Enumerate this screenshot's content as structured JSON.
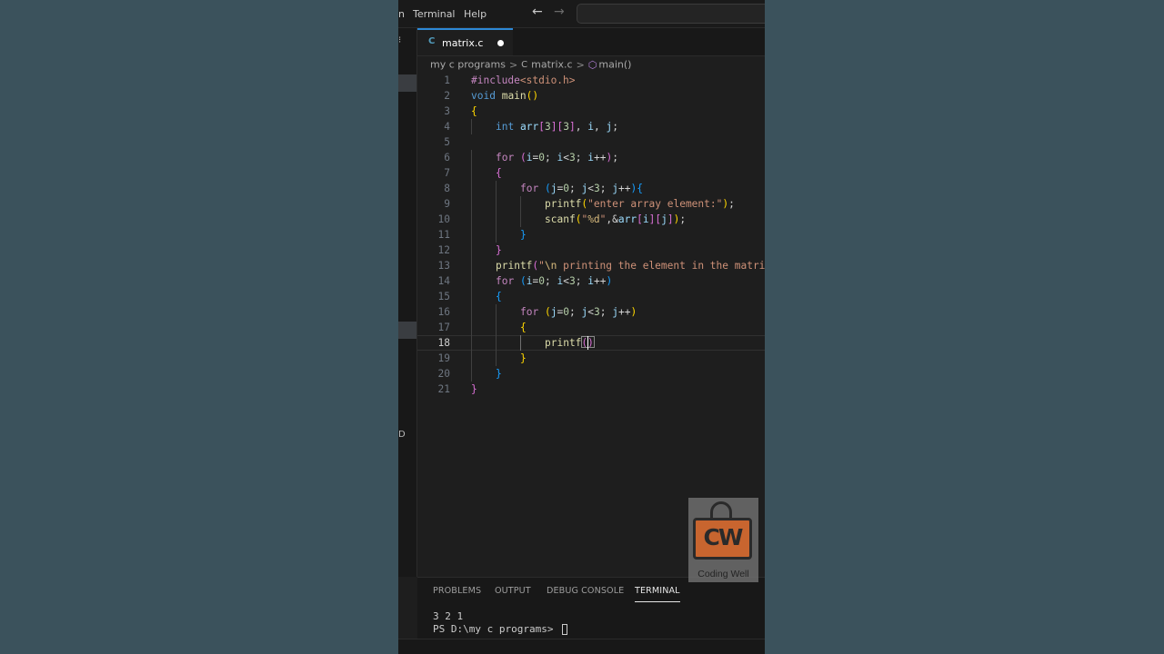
{
  "menu": {
    "terminal": "Terminal",
    "help": "Help",
    "partial": "n"
  },
  "nav": {
    "back": "←",
    "forward": "→"
  },
  "tab": {
    "file_label": "matrix.c",
    "lang_badge": "C"
  },
  "breadcrumb": {
    "folder": "my c programs",
    "file": "matrix.c",
    "symbol": "main()",
    "lang_badge": "C",
    "separator": ">"
  },
  "leftstrip": {
    "glyph_a": "⁝",
    "glyph_b": "D"
  },
  "code_lines": [
    "#include<stdio.h>",
    "void main()",
    "{",
    "    int arr[3][3], i, j;",
    "",
    "    for (i=0; i<3; i++);",
    "    {",
    "        for (j=0; j<3; j++){",
    "            printf(\"enter array element:\");",
    "            scanf(\"%d\",&arr[i][j]);",
    "        }",
    "    }",
    "    printf(\"\\n printing the element in the matri",
    "    for (i=0; i<3; i++)",
    "    {",
    "        for (j=0; j<3; j++)",
    "        {",
    "            printf()",
    "        }",
    "    }",
    "}"
  ],
  "editor": {
    "active_line": 18
  },
  "panel": {
    "tabs": [
      "PROBLEMS",
      "OUTPUT",
      "DEBUG CONSOLE",
      "TERMINAL"
    ],
    "active_tab": "TERMINAL",
    "terminal_lines": [
      "3 2 1",
      "PS D:\\my c programs> "
    ]
  },
  "watermark": {
    "letters": "CW",
    "label": "Coding Well"
  }
}
